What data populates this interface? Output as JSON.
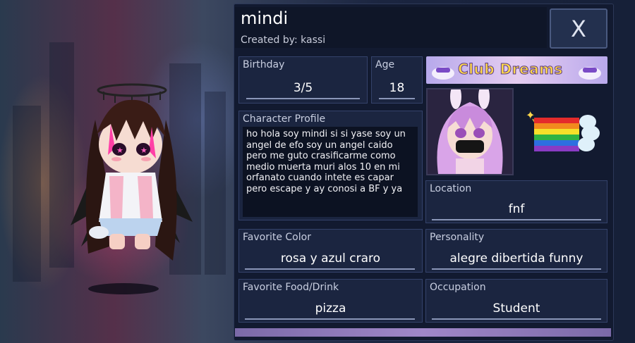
{
  "character": {
    "name": "mindi",
    "creator": "Created by: kassi"
  },
  "close_label": "X",
  "fields": {
    "birthday": {
      "label": "Birthday",
      "value": "3/5"
    },
    "age": {
      "label": "Age",
      "value": "18"
    },
    "profile": {
      "label": "Character Profile",
      "text": "ho hola soy mindi si si yase soy un angel de efo soy un angel caido pero me guto crasificarme como medio muerta muri alos 10 en mi orfanato cuando intete es capar pero escape y ay conosi a BF y ya"
    },
    "location": {
      "label": "Location",
      "value": "fnf"
    },
    "favorite_color": {
      "label": "Favorite Color",
      "value": "rosa y azul craro"
    },
    "personality": {
      "label": "Personality",
      "value": "alegre dibertida funny"
    },
    "favorite_food": {
      "label": "Favorite Food/Drink",
      "value": "pizza"
    },
    "occupation": {
      "label": "Occupation",
      "value": "Student"
    }
  },
  "banner": {
    "title": "Club Dreams"
  },
  "icons": [
    "close-icon",
    "rainbow-flag-icon",
    "sparkle-icon",
    "character-portrait",
    "character-sprite"
  ],
  "colors": {
    "panel": "#121a30",
    "box": "#1b2540",
    "accent": "#a087c8",
    "banner_text": "#ffd84a"
  }
}
